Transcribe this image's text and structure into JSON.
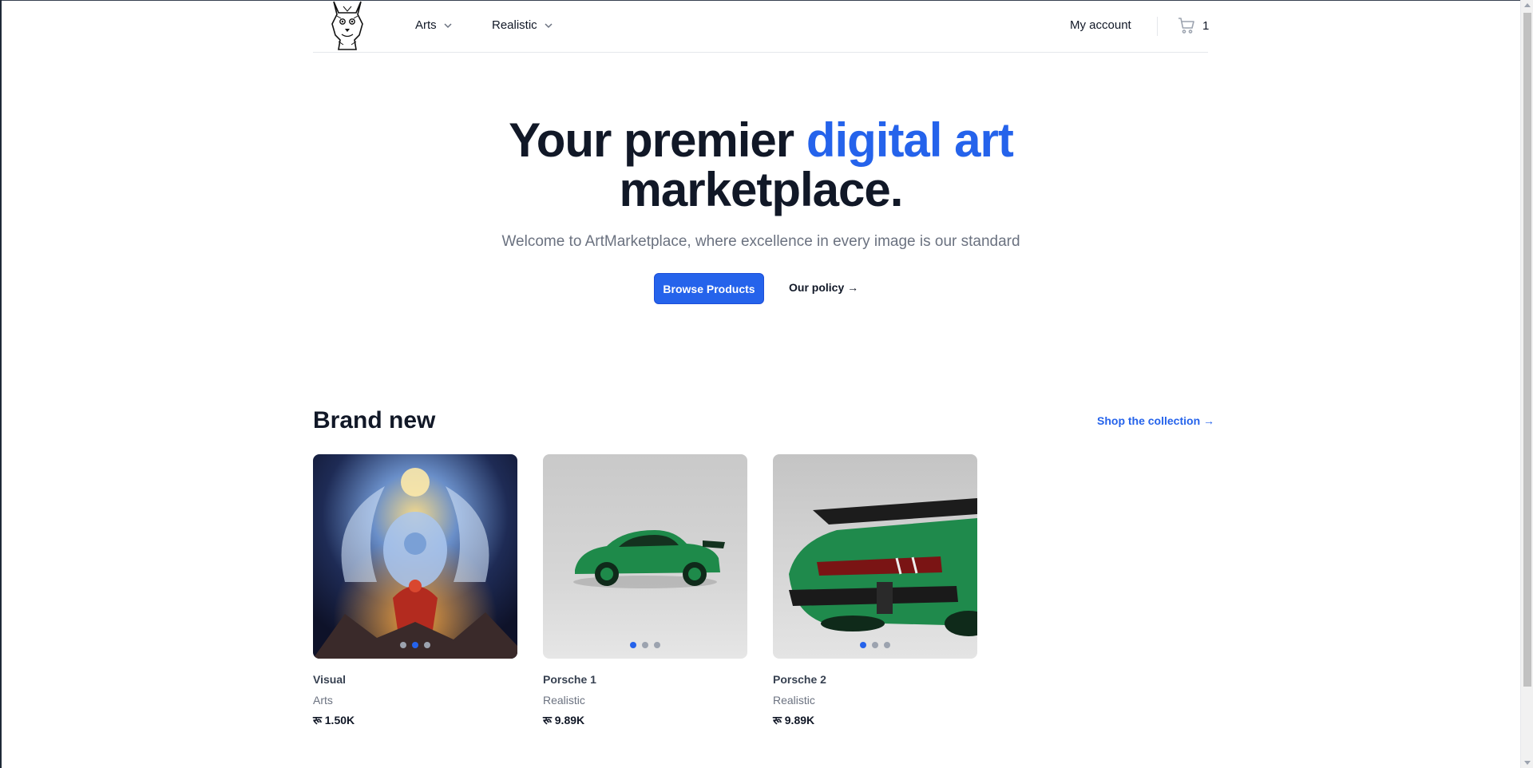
{
  "header": {
    "nav": [
      {
        "label": "Arts"
      },
      {
        "label": "Realistic"
      }
    ],
    "account_label": "My account",
    "cart_count": "1",
    "logo_icon": "wolf-logo-icon",
    "cart_icon": "cart-icon"
  },
  "hero": {
    "title_part1": "Your premier ",
    "title_accent": "digital art",
    "title_part2": "marketplace.",
    "subtitle": "Welcome to ArtMarketplace, where excellence in every image is our standard",
    "primary_button": "Browse Products",
    "secondary_link": "Our policy →"
  },
  "section": {
    "title": "Brand new",
    "shop_link": "Shop the collection →"
  },
  "products": [
    {
      "name": "Visual",
      "category": "Arts",
      "price": "रू 1.50K",
      "active_slide": 2,
      "slides": 3
    },
    {
      "name": "Porsche 1",
      "category": "Realistic",
      "price": "रू 9.89K",
      "active_slide": 1,
      "slides": 3
    },
    {
      "name": "Porsche 2",
      "category": "Realistic",
      "price": "रू 9.89K",
      "active_slide": 1,
      "slides": 3
    }
  ],
  "colors": {
    "accent": "#2563eb",
    "heading": "#111827",
    "muted": "#6b7280"
  }
}
